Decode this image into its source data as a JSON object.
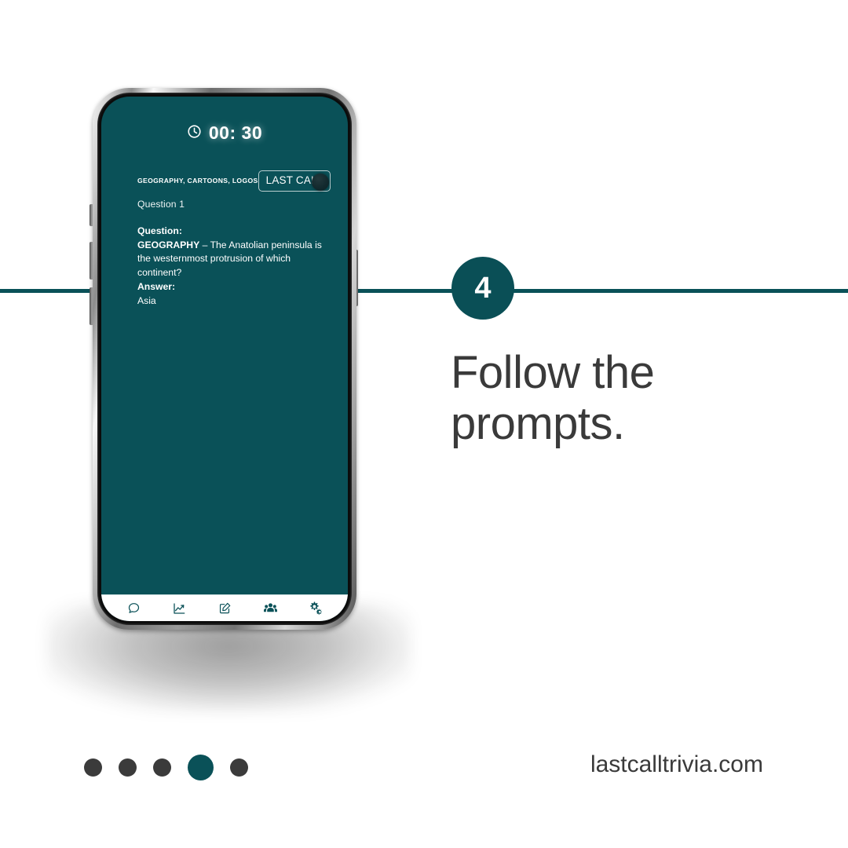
{
  "slide": {
    "step_number": "4",
    "headline_line1": "Follow the",
    "headline_line2": "prompts.",
    "site_url": "lastcalltrivia.com",
    "accent_color": "#0a5158",
    "badge_color": "#0a4f56",
    "text_color": "#3a3a3a"
  },
  "pagination": {
    "total": 5,
    "active_index": 4,
    "dots": [
      {
        "label": "slide-1",
        "active": false
      },
      {
        "label": "slide-2",
        "active": false
      },
      {
        "label": "slide-3",
        "active": false
      },
      {
        "label": "slide-4",
        "active": true
      },
      {
        "label": "slide-5",
        "active": false
      }
    ]
  },
  "phone": {
    "screen_bg": "#0a5158",
    "timer": {
      "icon": "clock-icon",
      "value": "00: 30"
    },
    "categories": "GEOGRAPHY, CARTOONS, LOGOS",
    "last_call_badge": "LAST CALL",
    "question_number": "Question 1",
    "question": {
      "label": "Question:",
      "category": "GEOGRAPHY",
      "separator": " – ",
      "text": "The Anatolian peninsula is the westernmost protrusion of which continent?"
    },
    "answer": {
      "label": "Answer:",
      "text": "Asia"
    },
    "nav": [
      {
        "name": "chat-icon",
        "label": "Chat"
      },
      {
        "name": "chart-icon",
        "label": "Scores"
      },
      {
        "name": "edit-icon",
        "label": "Compose"
      },
      {
        "name": "people-icon",
        "label": "Teams"
      },
      {
        "name": "settings-gears-icon",
        "label": "Settings"
      }
    ]
  }
}
